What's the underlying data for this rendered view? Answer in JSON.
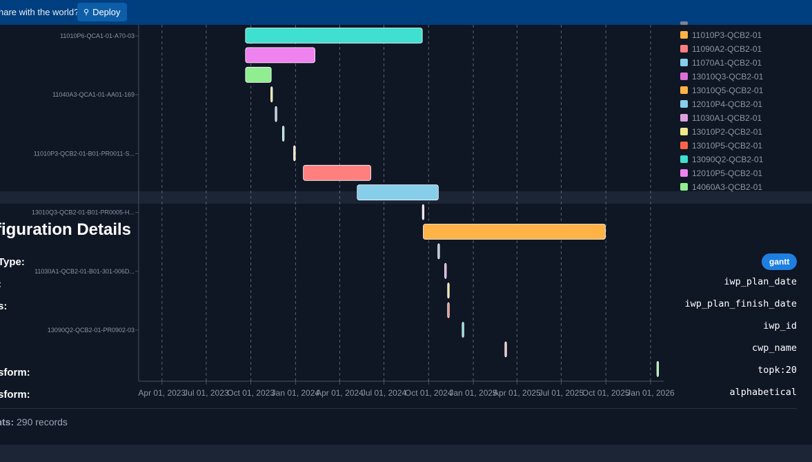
{
  "topbar": {
    "prompt_text": "hare with the world?",
    "deploy_label": "Deploy"
  },
  "details": {
    "title": "figuration Details",
    "rows": [
      {
        "label": "Type:",
        "value": "gantt"
      },
      {
        "label": ":",
        "value": "iwp_plan_date"
      },
      {
        "label": "s:",
        "value": "iwp_plan_finish_date"
      },
      {
        "label": "",
        "value": "iwp_id"
      },
      {
        "label": "",
        "value": "cwp_name"
      },
      {
        "label": "sform:",
        "value": "topk:20"
      },
      {
        "label": "sform:",
        "value": "alphabetical"
      }
    ],
    "datapoints_label": "oints:",
    "datapoints_value": "290 records"
  },
  "chart_data": {
    "type": "gantt",
    "x_tick_labels": [
      "Apr 01, 2023",
      "Jul 01, 2023",
      "Oct 01, 2023",
      "Jan 01, 2024",
      "Apr 01, 2024",
      "Jul 01, 2024",
      "Oct 01, 2024",
      "Jan 01, 2025",
      "Apr 01, 2025",
      "Jul 01, 2025",
      "Oct 01, 2025",
      "Jan 01, 2026"
    ],
    "xlim": [
      "2023-02-12",
      "2026-01-28"
    ],
    "grid": "vertical dashed",
    "y_labels": [
      "11010P6-QCA1-01-A70-03",
      "11040A3-QCA1-01-AA01-169",
      "11010P3-QCB2-01-B01-PR0011-S...",
      "13010Q3-QCB2-01-B01-PR0005-H...",
      "11030A1-QCB2-01-B01-301-006D...",
      "13090Q2-QCB2-01-PR0902-03"
    ],
    "tasks": [
      {
        "start": "2023-09-20",
        "end": "2024-09-18",
        "color": "#40e0d0"
      },
      {
        "start": "2023-09-20",
        "end": "2024-02-10",
        "color": "#ee82ee"
      },
      {
        "start": "2023-09-20",
        "end": "2023-11-12",
        "color": "#90ee90"
      },
      {
        "start": "2023-11-11",
        "end": "2023-11-14",
        "color": "#f0e68c"
      },
      {
        "start": "2023-11-20",
        "end": "2023-11-23",
        "color": "#b0c4de"
      },
      {
        "start": "2023-12-05",
        "end": "2023-12-08",
        "color": "#98d8c8"
      },
      {
        "start": "2023-12-28",
        "end": "2023-12-31",
        "color": "#ffe4b5"
      },
      {
        "start": "2024-01-17",
        "end": "2024-06-04",
        "color": "#ff7f7f"
      },
      {
        "start": "2024-05-07",
        "end": "2024-10-21",
        "color": "#87ceeb"
      },
      {
        "start": "2024-09-18",
        "end": "2024-09-21",
        "color": "#ffd1dc"
      },
      {
        "start": "2024-09-20",
        "end": "2025-09-30",
        "color": "#ffb347"
      },
      {
        "start": "2024-10-20",
        "end": "2024-10-23",
        "color": "#b0c4de"
      },
      {
        "start": "2024-11-03",
        "end": "2024-11-06",
        "color": "#dda0dd"
      },
      {
        "start": "2024-11-09",
        "end": "2024-11-12",
        "color": "#f0e68c"
      },
      {
        "start": "2024-11-09",
        "end": "2024-11-12",
        "color": "#ff8c7a"
      },
      {
        "start": "2024-12-09",
        "end": "2024-12-12",
        "color": "#7fdbda"
      },
      {
        "start": "2025-03-07",
        "end": "2025-03-10",
        "color": "#ffb6c1"
      },
      {
        "start": "2026-01-14",
        "end": "2026-01-17",
        "color": "#90ee90"
      }
    ],
    "legend": [
      {
        "name": "11010P3-QCB2-01",
        "color": "#ffb347"
      },
      {
        "name": "11090A2-QCB2-01",
        "color": "#ff7f7f"
      },
      {
        "name": "11070A1-QCB2-01",
        "color": "#87ceeb"
      },
      {
        "name": "13010Q3-QCB2-01",
        "color": "#da70d6"
      },
      {
        "name": "13010Q5-QCB2-01",
        "color": "#ffb347"
      },
      {
        "name": "12010P4-QCB2-01",
        "color": "#87ceeb"
      },
      {
        "name": "11030A1-QCB2-01",
        "color": "#dda0dd"
      },
      {
        "name": "13010P2-QCB2-01",
        "color": "#f0e68c"
      },
      {
        "name": "13010P5-QCB2-01",
        "color": "#ff6347"
      },
      {
        "name": "13090Q2-QCB2-01",
        "color": "#40e0d0"
      },
      {
        "name": "12010P5-QCB2-01",
        "color": "#ee82ee"
      },
      {
        "name": "14060A3-QCB2-01",
        "color": "#90ee90"
      }
    ]
  }
}
